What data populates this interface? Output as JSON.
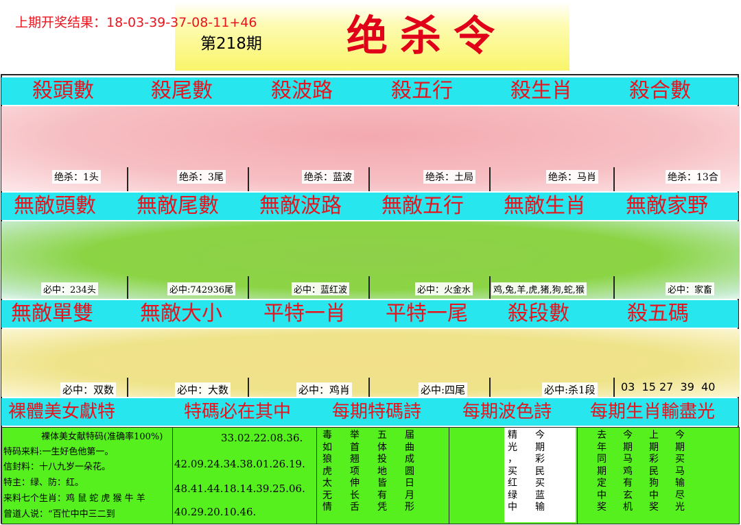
{
  "last_result": "上期开奖结果：18-03-39-37-08-11+46",
  "issue": "第218期",
  "brand": "绝杀令",
  "row1": {
    "headers": [
      "殺頭數",
      "殺尾數",
      "殺波路",
      "殺五行",
      "殺生肖",
      "殺合數"
    ],
    "values": [
      "绝杀：1头",
      "绝杀：3尾",
      "绝杀：蓝波",
      "绝杀：土局",
      "绝杀：马肖",
      "绝杀：13合"
    ]
  },
  "row2": {
    "headers": [
      "無敵頭數",
      "無敵尾數",
      "無敵波路",
      "無敵五行",
      "無敵生肖",
      "無敵家野"
    ],
    "values": [
      "必中：234头",
      "必中:742936尾",
      "必中：蓝红波",
      "必中：火金水",
      "鸡,兔,羊,虎,猪,狗,蛇,猴",
      "必中：家畜"
    ]
  },
  "row3": {
    "headers": [
      "無敵單雙",
      "無敵大小",
      "平特一肖",
      "平特一尾",
      "殺段數",
      "殺五碼"
    ],
    "values": [
      "必中：双数",
      "必中：大数",
      "必中：鸡肖",
      "必中:四尾",
      "必中:杀1段",
      "03  15 27  39  40"
    ]
  },
  "row4": {
    "headers": [
      "裸體美女獻特",
      "特碼必在其中",
      "每期特碼詩",
      "每期波色詩",
      "每期生肖輸盡光"
    ]
  },
  "info_lines": [
    "裸体美女献特码(准确率100%)",
    "特码来料:一生好色他第一。",
    "信封料：十八九岁一朵花。",
    "特主：绿、防：红。",
    "来料七个生肖：鸡 鼠 蛇 虎 猴 牛 羊",
    "曾道人说：“百忙中中三二到"
  ],
  "numbers": [
    "33.02.22.08.36.",
    "42.09.24.34.38.01.26.19.",
    "48.41.44.18.14.39.25.06.",
    "40.29.20.10.46."
  ],
  "poem_special": [
    [
      "毒",
      "举",
      "五",
      "届"
    ],
    [
      "如",
      "首",
      "体",
      "曲"
    ],
    [
      "狼",
      "翘",
      "投",
      "成"
    ],
    [
      "虎",
      "项",
      "地",
      "圆"
    ],
    [
      "太",
      "伸",
      "皆",
      "日"
    ],
    [
      "无",
      "长",
      "有",
      "月"
    ],
    [
      "情",
      "舌",
      "凭",
      "形"
    ]
  ],
  "poem_color": [
    [
      "精",
      "今"
    ],
    [
      "光",
      "期"
    ],
    [
      "，",
      "彩"
    ],
    [
      "买",
      "民"
    ],
    [
      "红",
      "买"
    ],
    [
      "绿",
      "蓝"
    ],
    [
      "中",
      "输"
    ]
  ],
  "poem_zodiac": [
    [
      "去",
      "今",
      "上",
      "今"
    ],
    [
      "年",
      "期",
      "期",
      "期"
    ],
    [
      "同",
      "马",
      "彩",
      "买"
    ],
    [
      "期",
      "鸡",
      "民",
      "马"
    ],
    [
      "定",
      "有",
      "狗",
      "输"
    ],
    [
      "中",
      "玄",
      "中",
      "尽"
    ],
    [
      "奖",
      "机",
      "奖",
      "光"
    ]
  ],
  "colors": {
    "header_bg": "#27e6ee",
    "header_text": "#e6141e",
    "pink": "#f4b8bd",
    "green": "#8bd444",
    "yellow": "#efe38a",
    "bright_green": "#55f01e"
  }
}
